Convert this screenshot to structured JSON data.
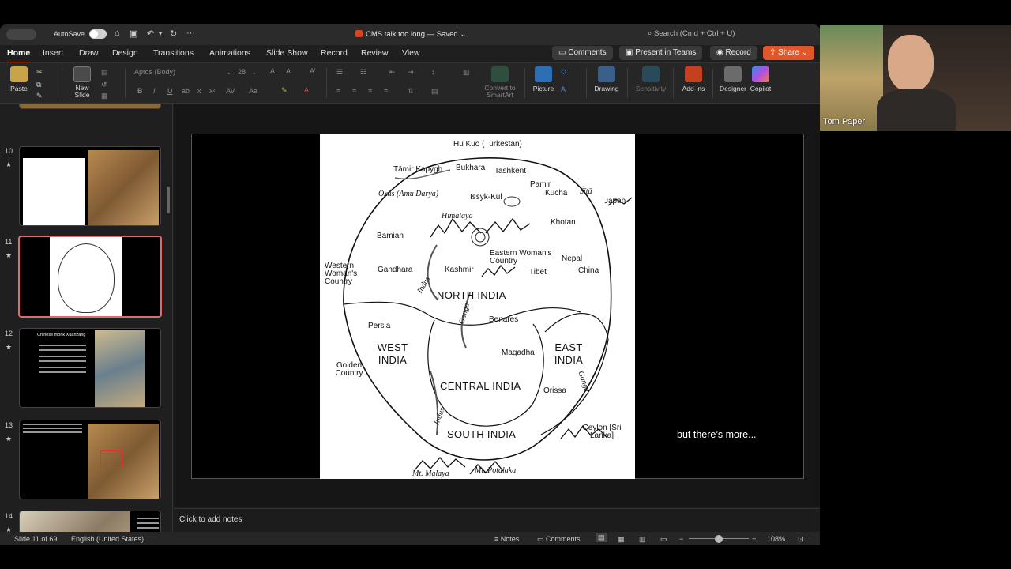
{
  "titlebar": {
    "autosave": "AutoSave",
    "title": "CMS talk too long",
    "saved": "Saved",
    "search": "Search (Cmd + Ctrl + U)"
  },
  "menu": {
    "tabs": [
      "Home",
      "Insert",
      "Draw",
      "Design",
      "Transitions",
      "Animations",
      "Slide Show",
      "Record",
      "Review",
      "View"
    ],
    "comments": "Comments",
    "present": "Present in Teams",
    "record": "Record",
    "share": "Share"
  },
  "ribbon": {
    "paste": "Paste",
    "new_slide": "New Slide",
    "font": "Aptos (Body)",
    "size": "28",
    "convert": "Convert to SmartArt",
    "picture": "Picture",
    "drawing": "Drawing",
    "sensitivity": "Sensitivity",
    "addins": "Add-ins",
    "designer": "Designer",
    "copilot": "Copilot"
  },
  "thumbs": [
    {
      "num": "10"
    },
    {
      "num": "11"
    },
    {
      "num": "12",
      "title": "Chinese monk Xuanzang"
    },
    {
      "num": "13"
    },
    {
      "num": "14"
    }
  ],
  "slide": {
    "caption": "but there’s more...",
    "map_labels": {
      "hu_kuo": "Hu Kuo (Turkestan)",
      "tamir": "Tāmir Kapygh",
      "bukhara": "Bukhara",
      "tashkent": "Tashkent",
      "oxus": "Oxus (Amu Darya)",
      "issyk": "Issyk-Kul",
      "pamir": "Pamir",
      "kucha": "Kucha",
      "sita": "Śītā",
      "japan": "Japan",
      "himalaya": "Himalaya",
      "khotan": "Khotan",
      "bamian": "Bamian",
      "eastern": "Eastern Woman's Country",
      "nepal": "Nepal",
      "western": "Western Woman's Country",
      "gandhara": "Gandhara",
      "kashmir": "Kashmir",
      "tibet": "Tibet",
      "china": "China",
      "north": "NORTH  INDIA",
      "indus": "Indus",
      "ganga": "Ganga",
      "persia": "Persia",
      "benares": "Benares",
      "west": "WEST INDIA",
      "east": "EAST INDIA",
      "magadha": "Magadha",
      "golden": "Golden Country",
      "central": "CENTRAL INDIA",
      "orissa": "Orissa",
      "ganga2": "Ganga",
      "indus2": "Indus",
      "ceylon": "Ceylon [Sri Lanka]",
      "south": "SOUTH INDIA",
      "malaya": "Mt. Malaya",
      "potalaka": "Mt. Potalaka"
    }
  },
  "notes": {
    "placeholder": "Click to add notes"
  },
  "status": {
    "slide": "Slide 11 of 69",
    "lang": "English (United States)",
    "notes": "Notes",
    "comments": "Comments",
    "zoom": "108%"
  },
  "webcam": {
    "name": "Tom Paper"
  }
}
